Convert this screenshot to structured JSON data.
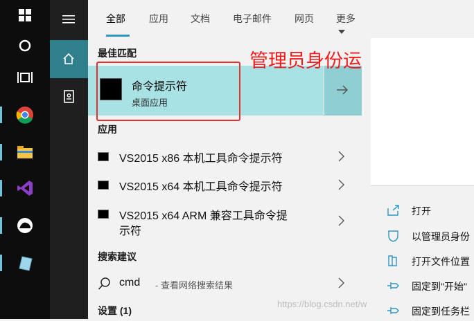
{
  "tabs": [
    {
      "label": "全部"
    },
    {
      "label": "应用"
    },
    {
      "label": "文档"
    },
    {
      "label": "电子邮件"
    },
    {
      "label": "网页"
    },
    {
      "label": "更多"
    }
  ],
  "sections": {
    "best_match": "最佳匹配",
    "apps": "应用",
    "search_suggestions": "搜索建议",
    "settings": "设置 (1)"
  },
  "best_match": {
    "title": "命令提示符",
    "subtitle": "桌面应用"
  },
  "annotation": "管理员身份运行",
  "apps": [
    {
      "label": "VS2015 x86 本机工具命令提示符"
    },
    {
      "label": "VS2015 x64 本机工具命令提示符"
    },
    {
      "label": "VS2015 x64 ARM 兼容工具命令提",
      "label2": "示符"
    }
  ],
  "suggestion": {
    "query": "cmd",
    "rest": "- 查看网络搜索结果"
  },
  "actions": [
    {
      "label": "打开",
      "icon": "open-icon"
    },
    {
      "label": "以管理员身份",
      "icon": "shield-icon"
    },
    {
      "label": "打开文件位置",
      "icon": "folder-icon"
    },
    {
      "label": "固定到\"开始\"",
      "icon": "pin-icon"
    },
    {
      "label": "固定到任务栏",
      "icon": "pin-icon"
    }
  ],
  "watermark": "https://blog.csdn.net/w",
  "colors": {
    "accent": "#2e96c4",
    "best_match_bg": "#a9e2e5",
    "annotation": "#ee1c1c",
    "taskbar": "#0d0d0d"
  }
}
